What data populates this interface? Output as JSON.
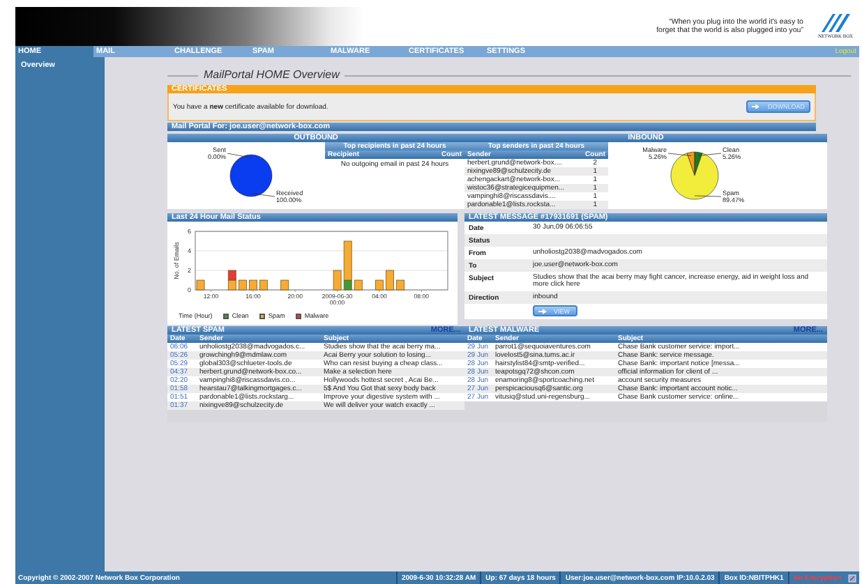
{
  "header": {
    "tagline": [
      "“When you plug into the world it's easy to",
      "forget that the world is also plugged into you”"
    ],
    "logo_text": "NETWORK BOX"
  },
  "nav": {
    "tabs": [
      {
        "label": "HOME",
        "selected": true
      },
      {
        "label": "MAIL",
        "selected": false
      },
      {
        "label": "CHALLENGE",
        "selected": false
      },
      {
        "label": "SPAM",
        "selected": false
      },
      {
        "label": "MALWARE",
        "selected": false
      },
      {
        "label": "CERTIFICATES",
        "selected": false
      },
      {
        "label": "SETTINGS",
        "selected": false
      }
    ],
    "logout": "Logout"
  },
  "sidebar": {
    "items": [
      {
        "label": "Overview"
      }
    ]
  },
  "page_title": "MailPortal HOME Overview",
  "certificates": {
    "title": "CERTIFICATES",
    "message": "You have a **new** certificate available for download.",
    "button": "DOWNLOAD"
  },
  "mail_portal": {
    "title": "Mail Portal For: joe.user@network-box.com"
  },
  "outbound": {
    "title": "OUTBOUND",
    "chart_data": {
      "type": "pie",
      "categories": [
        "Sent",
        "Received"
      ],
      "values": [
        0,
        100
      ],
      "colors": [
        "#b0b0b0",
        "#0a3cf0"
      ],
      "value_labels": [
        "0.00%",
        "100.00%"
      ]
    },
    "top_recipients": {
      "title": "Top recipients in past 24 hours",
      "columns": [
        "Recipient",
        "Count"
      ],
      "empty_message": "No outgoing email in past 24 hours"
    }
  },
  "inbound": {
    "title": "INBOUND",
    "top_senders": {
      "title": "Top senders in past 24 hours",
      "columns": [
        "Sender",
        "Count"
      ],
      "rows": [
        {
          "sender": "herbert.grund@network-box....",
          "count": "2"
        },
        {
          "sender": "nixingve89@schulzecity.de",
          "count": "1"
        },
        {
          "sender": "achengackart@network-box...",
          "count": "1"
        },
        {
          "sender": "wistoc36@strategicequipmen...",
          "count": "1"
        },
        {
          "sender": "vampinghi8@riscassdavis....",
          "count": "1"
        },
        {
          "sender": "pardonable1@lists.rocksta...",
          "count": "1"
        }
      ]
    },
    "chart_data": {
      "type": "pie",
      "categories": [
        "Malware",
        "Clean",
        "Spam"
      ],
      "values": [
        5.26,
        5.26,
        89.47
      ],
      "colors": [
        "#f59a1a",
        "#1e7a1e",
        "#f2ec3a"
      ],
      "value_labels": [
        "5.26%",
        "5.26%",
        "89.47%"
      ]
    }
  },
  "mail_status": {
    "title": "Last 24 Hour Mail Status",
    "chart_data": {
      "type": "bar",
      "stacked": true,
      "xlabel": "Time (Hour)",
      "ylabel": "No. of Emails",
      "x": [
        "2009-06-29 11:00",
        "2009-06-29 12:00",
        "2009-06-29 13:00",
        "2009-06-29 14:00",
        "2009-06-29 15:00",
        "2009-06-29 16:00",
        "2009-06-29 17:00",
        "2009-06-29 18:00",
        "2009-06-29 19:00",
        "2009-06-29 20:00",
        "2009-06-29 21:00",
        "2009-06-29 22:00",
        "2009-06-29 23:00",
        "2009-06-30 00:00",
        "2009-06-30 01:00",
        "2009-06-30 02:00",
        "2009-06-30 03:00",
        "2009-06-30 04:00",
        "2009-06-30 05:00",
        "2009-06-30 06:00",
        "2009-06-30 07:00",
        "2009-06-30 08:00",
        "2009-06-30 09:00",
        "2009-06-30 10:00"
      ],
      "xlim": [
        "2009-06-29 10:30",
        "2009-06-30 10:30"
      ],
      "grid": true,
      "series": [
        {
          "name": "Clean",
          "color": "#3d9a3d",
          "values": [
            0,
            0,
            0,
            0,
            0,
            0,
            0,
            0,
            0,
            0,
            0,
            0,
            0,
            0,
            1,
            0,
            0,
            0,
            0,
            0,
            0,
            0,
            0,
            0
          ]
        },
        {
          "name": "Spam",
          "color": "#f5ab35",
          "values": [
            1,
            0,
            0,
            1,
            1,
            1,
            1,
            0,
            1,
            0,
            0,
            0,
            0,
            2,
            4,
            1,
            0,
            1,
            2,
            1,
            0,
            0,
            0,
            0
          ]
        },
        {
          "name": "Malware",
          "color": "#e23b3b",
          "values": [
            0,
            0,
            0,
            1,
            0,
            0,
            0,
            0,
            0,
            0,
            0,
            0,
            0,
            0,
            0,
            0,
            0,
            0,
            0,
            0,
            0,
            0,
            0,
            0
          ]
        }
      ],
      "ylim": [
        0,
        6
      ],
      "yticks": [
        0,
        2,
        4,
        6
      ],
      "xticks": [
        {
          "value": "2009-06-29 12:00",
          "label": "12:00"
        },
        {
          "value": "2009-06-29 16:00",
          "label": "16:00"
        },
        {
          "value": "2009-06-29 20:00",
          "label": "20:00"
        },
        {
          "value": "2009-06-30 00:00",
          "label": "2009-06-30 00:00"
        },
        {
          "value": "2009-06-30 04:00",
          "label": "04:00"
        },
        {
          "value": "2009-06-30 08:00",
          "label": "08:00"
        }
      ]
    }
  },
  "latest_message": {
    "title": "LATEST MESSAGE #17931691 (SPAM)",
    "fields": [
      {
        "label": "Date",
        "value": "30 Jun,09 06:06:55"
      },
      {
        "label": "Status"
      },
      {
        "label": "From",
        "value": "unholiostg2038@madvogados.com"
      },
      {
        "label": "To",
        "value": "joe.user@network-box.com"
      },
      {
        "label": "Subject",
        "value": "Studies show that the acai berry may fight cancer, increase energy, aid in weight loss and more click here"
      },
      {
        "label": "Direction",
        "value": "inbound"
      }
    ],
    "button": "VIEW"
  },
  "latest_spam": {
    "title": "LATEST SPAM",
    "more": "MORE...",
    "columns": [
      "Date",
      "Sender",
      "Subject"
    ],
    "rows": [
      [
        "06:06",
        "unholiostg2038@madvogados.c...",
        "Studies show that the acai berry ma..."
      ],
      [
        "05:26",
        "growchingh9@mdmlaw.com",
        "Acai Berry your solution to losing..."
      ],
      [
        "05:29",
        "global303@schlueter-tools.de",
        "Who can resist buying a cheap class..."
      ],
      [
        "04:37",
        "herbert.grund@network-box.co...",
        "Make a selection here"
      ],
      [
        "02:20",
        "vampinghi8@riscassdavis.co...",
        "Hollywoods hottest secret , Acai Be..."
      ],
      [
        "01:58",
        "hearstau7@talkingmortgages.c...",
        "5$ And You Got that sexy body back"
      ],
      [
        "01:51",
        "pardonable1@lists.rockstarg...",
        "Improve your digestive system with ..."
      ],
      [
        "01:37",
        "nixingve89@schulzecity.de",
        "We will deliver your watch exactly ..."
      ]
    ]
  },
  "latest_malware": {
    "title": "LATEST MALWARE",
    "more": "MORE...",
    "columns": [
      "Date",
      "Sender",
      "Subject"
    ],
    "rows": [
      [
        "29 Jun",
        "parrot1@sequoiaventures.com",
        "Chase Bank customer service: import..."
      ],
      [
        "29 Jun",
        "lovelost5@sina.tums.ac.ir",
        "Chase Bank: service message."
      ],
      [
        "28 Jun",
        "hairstylist84@smtp-verified...",
        "Chase Bank: important notice [messa..."
      ],
      [
        "28 Jun",
        "teapotsgq72@shcon.com",
        "official information for client of ..."
      ],
      [
        "28 Jun",
        "enamoring8@sportcoaching.net",
        "account security measures"
      ],
      [
        "27 Jun",
        "perspicaciousq6@santic.org",
        "Chase Bank: important account notic..."
      ],
      [
        "27 Jun",
        "vitusiq@stud.uni-regensburg...",
        "Chase Bank customer service: online..."
      ]
    ]
  },
  "footer": {
    "copyright": "Copyright © 2002-2007 Network Box Corporation",
    "items": [
      "2009-6-30 10:32:28 AM",
      "Up: 67 days 18 hours",
      "User:joe.user@network-box.com  IP:10.0.2.03",
      "Box ID:NBITPHK1"
    ],
    "encryption": "No Encryption"
  }
}
